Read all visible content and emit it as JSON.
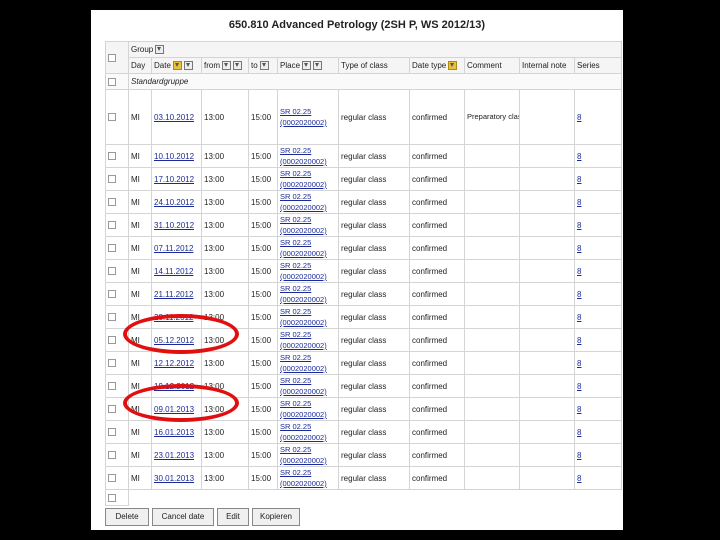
{
  "title": "650.810 Advanced Petrology (2SH P, WS 2012/13)",
  "header": {
    "group_label": "Group",
    "day": "Day",
    "date": "Date",
    "from": "from",
    "to": "to",
    "place": "Place",
    "type": "Type of class",
    "datetype": "Date type",
    "comment": "Comment",
    "internal_note": "Internal note",
    "series": "Series"
  },
  "group_name": "Standardgruppe",
  "rows": [
    {
      "day": "MI",
      "date": "03.10.2012",
      "from": "13:00",
      "to": "15:00",
      "place1": "SR 02.25",
      "place2": "(0002020002)",
      "type": "regular class",
      "datetype": "confirmed",
      "comment": "Preparatory class to discuss the scheduled dates",
      "series": "8"
    },
    {
      "day": "MI",
      "date": "10.10.2012",
      "from": "13:00",
      "to": "15:00",
      "place1": "SR 02.25",
      "place2": "(0002020002)",
      "type": "regular class",
      "datetype": "confirmed",
      "comment": "",
      "series": "8"
    },
    {
      "day": "MI",
      "date": "17.10.2012",
      "from": "13:00",
      "to": "15:00",
      "place1": "SR 02.25",
      "place2": "(0002020002)",
      "type": "regular class",
      "datetype": "confirmed",
      "comment": "",
      "series": "8"
    },
    {
      "day": "MI",
      "date": "24.10.2012",
      "from": "13:00",
      "to": "15:00",
      "place1": "SR 02.25",
      "place2": "(0002020002)",
      "type": "regular class",
      "datetype": "confirmed",
      "comment": "",
      "series": "8"
    },
    {
      "day": "MI",
      "date": "31.10.2012",
      "from": "13:00",
      "to": "15:00",
      "place1": "SR 02.25",
      "place2": "(0002020002)",
      "type": "regular class",
      "datetype": "confirmed",
      "comment": "",
      "series": "8"
    },
    {
      "day": "MI",
      "date": "07.11.2012",
      "from": "13:00",
      "to": "15:00",
      "place1": "SR 02.25",
      "place2": "(0002020002)",
      "type": "regular class",
      "datetype": "confirmed",
      "comment": "",
      "series": "8"
    },
    {
      "day": "MI",
      "date": "14.11.2012",
      "from": "13:00",
      "to": "15:00",
      "place1": "SR 02.25",
      "place2": "(0002020002)",
      "type": "regular class",
      "datetype": "confirmed",
      "comment": "",
      "series": "8"
    },
    {
      "day": "MI",
      "date": "21.11.2012",
      "from": "13:00",
      "to": "15:00",
      "place1": "SR 02.25",
      "place2": "(0002020002)",
      "type": "regular class",
      "datetype": "confirmed",
      "comment": "",
      "series": "8"
    },
    {
      "day": "MI",
      "date": "28.11.2012",
      "from": "13:00",
      "to": "15:00",
      "place1": "SR 02.25",
      "place2": "(0002020002)",
      "type": "regular class",
      "datetype": "confirmed",
      "comment": "",
      "series": "8"
    },
    {
      "day": "MI",
      "date": "05.12.2012",
      "from": "13:00",
      "to": "15:00",
      "place1": "SR 02.25",
      "place2": "(0002020002)",
      "type": "regular class",
      "datetype": "confirmed",
      "comment": "",
      "series": "8"
    },
    {
      "day": "MI",
      "date": "12.12.2012",
      "from": "13:00",
      "to": "15:00",
      "place1": "SR 02.25",
      "place2": "(0002020002)",
      "type": "regular class",
      "datetype": "confirmed",
      "comment": "",
      "series": "8"
    },
    {
      "day": "MI",
      "date": "19.12.2012",
      "from": "13:00",
      "to": "15:00",
      "place1": "SR 02.25",
      "place2": "(0002020002)",
      "type": "regular class",
      "datetype": "confirmed",
      "comment": "",
      "series": "8"
    },
    {
      "day": "MI",
      "date": "09.01.2013",
      "from": "13:00",
      "to": "15:00",
      "place1": "SR 02.25",
      "place2": "(0002020002)",
      "type": "regular class",
      "datetype": "confirmed",
      "comment": "",
      "series": "8"
    },
    {
      "day": "MI",
      "date": "16.01.2013",
      "from": "13:00",
      "to": "15:00",
      "place1": "SR 02.25",
      "place2": "(0002020002)",
      "type": "regular class",
      "datetype": "confirmed",
      "comment": "",
      "series": "8"
    },
    {
      "day": "MI",
      "date": "23.01.2013",
      "from": "13:00",
      "to": "15:00",
      "place1": "SR 02.25",
      "place2": "(0002020002)",
      "type": "regular class",
      "datetype": "confirmed",
      "comment": "",
      "series": "8"
    },
    {
      "day": "MI",
      "date": "30.01.2013",
      "from": "13:00",
      "to": "15:00",
      "place1": "SR 02.25",
      "place2": "(0002020002)",
      "type": "regular class",
      "datetype": "confirmed",
      "comment": "",
      "series": "8"
    }
  ],
  "buttons": {
    "delete": "Delete",
    "cancel": "Cancel date",
    "edit": "Edit",
    "copy": "Kopieren"
  },
  "highlight_color": "#e01010"
}
